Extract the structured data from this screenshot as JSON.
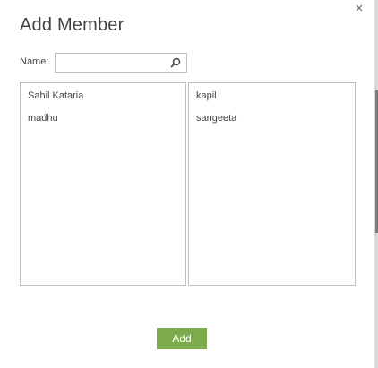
{
  "dialog": {
    "title": "Add Member",
    "close_glyph": "×"
  },
  "search": {
    "label": "Name:",
    "value": "",
    "placeholder": "",
    "icon": "search-icon"
  },
  "left_list": {
    "items": [
      {
        "label": "Sahil Kataria"
      },
      {
        "label": "madhu"
      }
    ]
  },
  "right_list": {
    "items": [
      {
        "label": "kapil"
      },
      {
        "label": "sangeeta"
      }
    ]
  },
  "actions": {
    "add_label": "Add",
    "add_color": "#7cab4b"
  }
}
